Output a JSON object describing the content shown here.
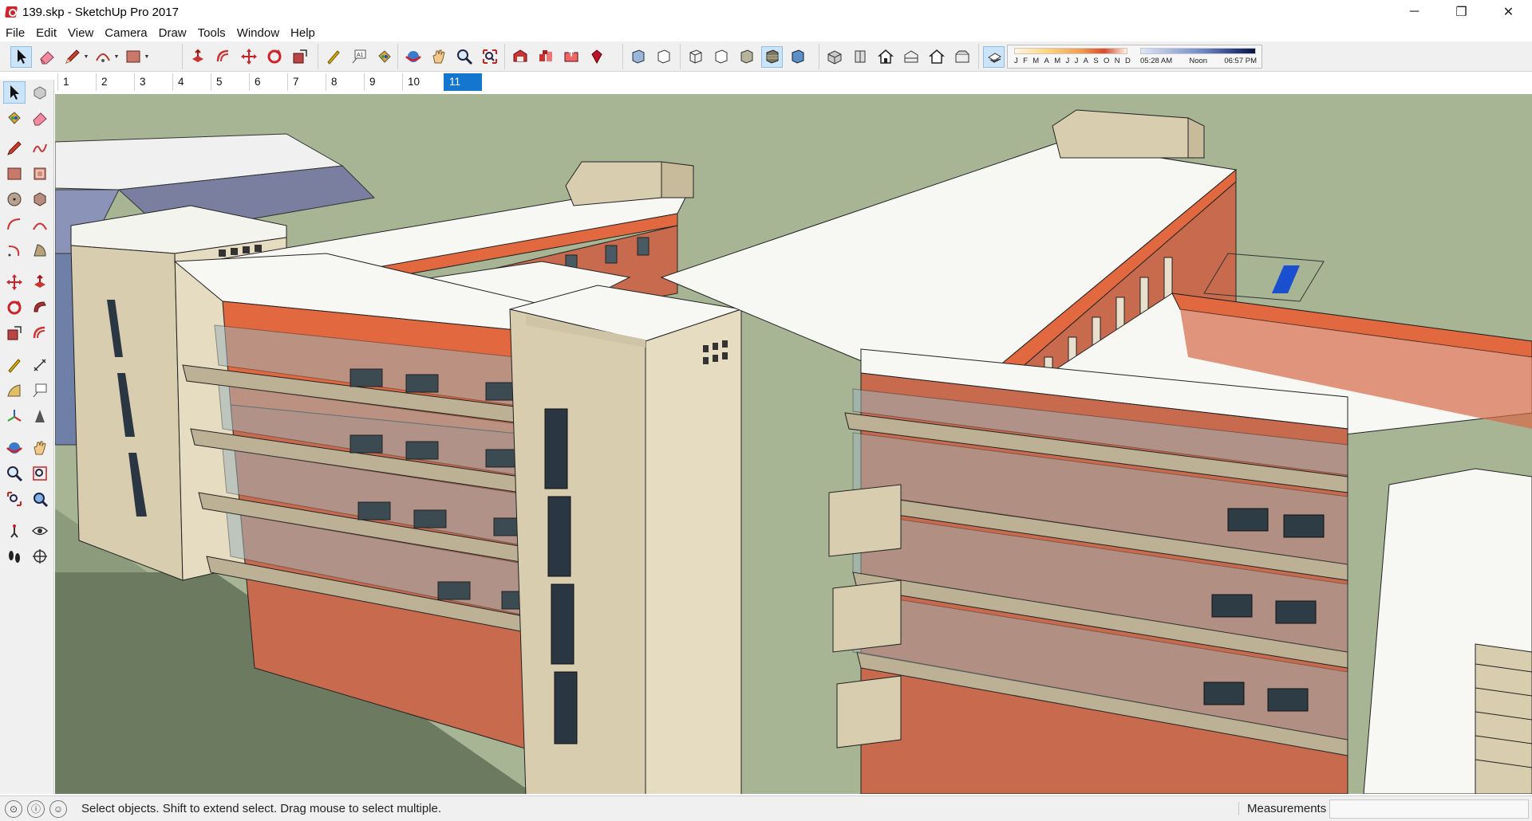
{
  "window": {
    "title": "139.skp - SketchUp Pro 2017",
    "minimize": "─",
    "maximize": "❐",
    "close": "✕"
  },
  "menu": [
    "File",
    "Edit",
    "View",
    "Camera",
    "Draw",
    "Tools",
    "Window",
    "Help"
  ],
  "toolbar": {
    "tools": [
      {
        "name": "select-tool",
        "icon": "arrow-icon"
      },
      {
        "name": "eraser-tool",
        "icon": "eraser-icon"
      },
      {
        "name": "line-tool",
        "icon": "pencil-icon",
        "dropdown": true
      },
      {
        "name": "arc-tool",
        "icon": "arc-icon",
        "dropdown": true
      },
      {
        "name": "shape-tool",
        "icon": "rectangle-icon",
        "dropdown": true
      },
      {
        "name": "push-pull-tool",
        "icon": "push-pull-icon"
      },
      {
        "name": "offset-tool",
        "icon": "offset-icon"
      },
      {
        "name": "move-tool",
        "icon": "move-icon"
      },
      {
        "name": "rotate-tool",
        "icon": "rotate-icon"
      },
      {
        "name": "scale-tool",
        "icon": "scale-icon"
      },
      {
        "name": "tape-measure-tool",
        "icon": "tape-icon"
      },
      {
        "name": "text-tool",
        "icon": "text-icon"
      },
      {
        "name": "paint-bucket-tool",
        "icon": "paint-bucket-icon"
      },
      {
        "name": "orbit-tool",
        "icon": "orbit-icon"
      },
      {
        "name": "pan-tool",
        "icon": "hand-icon"
      },
      {
        "name": "zoom-tool",
        "icon": "zoom-icon"
      },
      {
        "name": "zoom-extents-tool",
        "icon": "zoom-extents-icon"
      },
      {
        "name": "warehouse-tool",
        "icon": "warehouse-icon"
      },
      {
        "name": "components-tool",
        "icon": "components-icon"
      },
      {
        "name": "share-model-tool",
        "icon": "share-icon"
      },
      {
        "name": "extension-warehouse-tool",
        "icon": "ruby-icon"
      },
      {
        "name": "xray-style",
        "icon": "xray-icon"
      },
      {
        "name": "back-edges-style",
        "icon": "back-edges-icon"
      },
      {
        "name": "wireframe-style",
        "icon": "wireframe-icon"
      },
      {
        "name": "hidden-line-style",
        "icon": "hidden-line-icon"
      },
      {
        "name": "shaded-style",
        "icon": "shaded-icon"
      },
      {
        "name": "shaded-textures-style",
        "icon": "textures-icon",
        "active": true
      },
      {
        "name": "monochrome-style",
        "icon": "monochrome-icon"
      },
      {
        "name": "iso-view",
        "icon": "iso-icon"
      },
      {
        "name": "top-view",
        "icon": "top-view-icon"
      },
      {
        "name": "front-view",
        "icon": "front-view-icon"
      },
      {
        "name": "right-view",
        "icon": "right-view-icon"
      },
      {
        "name": "back-view",
        "icon": "back-view-icon"
      },
      {
        "name": "left-view",
        "icon": "left-view-icon"
      },
      {
        "name": "shadows-toggle",
        "icon": "shadow-icon",
        "active": true
      }
    ],
    "shadow": {
      "months": [
        "J",
        "F",
        "M",
        "A",
        "M",
        "J",
        "J",
        "A",
        "S",
        "O",
        "N",
        "D"
      ],
      "time_start": "05:28 AM",
      "time_mid": "Noon",
      "time_end": "06:57 PM"
    }
  },
  "scenes": {
    "tabs": [
      "1",
      "2",
      "3",
      "4",
      "5",
      "6",
      "7",
      "8",
      "9",
      "10",
      "11"
    ],
    "active": "11"
  },
  "palette": {
    "tools": [
      {
        "name": "select",
        "icon": "arrow-icon",
        "active": true
      },
      {
        "name": "make-component",
        "icon": "component-icon"
      },
      {
        "name": "paint-bucket",
        "icon": "paint-bucket-icon"
      },
      {
        "name": "eraser",
        "icon": "eraser-icon"
      },
      {
        "name": "line",
        "icon": "pencil-icon"
      },
      {
        "name": "freehand",
        "icon": "freehand-icon"
      },
      {
        "name": "rectangle",
        "icon": "rectangle-icon"
      },
      {
        "name": "rotated-rectangle",
        "icon": "rotated-rectangle-icon"
      },
      {
        "name": "circle",
        "icon": "circle-icon"
      },
      {
        "name": "polygon",
        "icon": "polygon-icon"
      },
      {
        "name": "arc",
        "icon": "arc-icon"
      },
      {
        "name": "two-point-arc",
        "icon": "arc2-icon"
      },
      {
        "name": "three-point-arc",
        "icon": "arc3-icon"
      },
      {
        "name": "pie",
        "icon": "pie-icon"
      },
      {
        "name": "move",
        "icon": "move-icon"
      },
      {
        "name": "push-pull",
        "icon": "push-pull-icon"
      },
      {
        "name": "rotate",
        "icon": "rotate-icon"
      },
      {
        "name": "follow-me",
        "icon": "follow-me-icon"
      },
      {
        "name": "scale",
        "icon": "scale-icon"
      },
      {
        "name": "offset",
        "icon": "offset-icon"
      },
      {
        "name": "tape-measure",
        "icon": "tape-icon"
      },
      {
        "name": "dimension",
        "icon": "dimension-icon"
      },
      {
        "name": "protractor",
        "icon": "protractor-icon"
      },
      {
        "name": "text",
        "icon": "text-icon"
      },
      {
        "name": "axes",
        "icon": "axes-icon"
      },
      {
        "name": "3d-text",
        "icon": "3d-text-icon"
      },
      {
        "name": "orbit",
        "icon": "orbit-icon"
      },
      {
        "name": "pan",
        "icon": "hand-icon"
      },
      {
        "name": "zoom",
        "icon": "zoom-icon"
      },
      {
        "name": "zoom-window",
        "icon": "zoom-window-icon"
      },
      {
        "name": "zoom-extents",
        "icon": "zoom-extents-icon"
      },
      {
        "name": "previous",
        "icon": "previous-icon"
      },
      {
        "name": "position-camera",
        "icon": "camera-icon"
      },
      {
        "name": "look-around",
        "icon": "eye-icon"
      },
      {
        "name": "walk",
        "icon": "footprints-icon"
      },
      {
        "name": "section-plane",
        "icon": "section-icon"
      }
    ]
  },
  "status": {
    "message": "Select objects. Shift to extend select. Drag mouse to select multiple.",
    "measurements_label": "Measurements",
    "measurements_value": ""
  },
  "colors": {
    "ground": "#a7b595",
    "wall_beige": "#d9cdb0",
    "wall_orange": "#e2683f",
    "roof_white": "#f7f7f3",
    "glass": "#9db4b8",
    "accent": "#1576d0"
  }
}
